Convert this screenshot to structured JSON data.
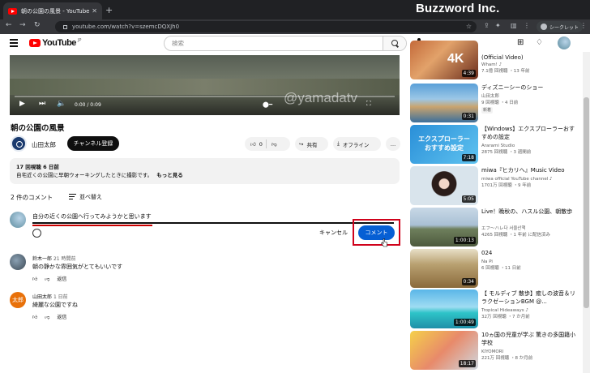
{
  "browser": {
    "tab_title": "朝の公園の風景 - YouTube",
    "new_tab": "+",
    "close": "✕",
    "url": "youtube.com/watch?v=szemcDQXJh0",
    "incognito_label": "シークレット",
    "brand_overlay": "Buzzword Inc."
  },
  "header": {
    "logo_text": "YouTube",
    "logo_jp": "JP",
    "search_placeholder": "検索"
  },
  "player": {
    "current_time": "0:00 / 0:09",
    "watermark": "@yamadatv",
    "progress": 0.0
  },
  "video": {
    "title": "朝の公園の風景",
    "channel_name": "山田太郎",
    "subscribe_label": "チャンネル登録",
    "like_count": "0",
    "share_label": "共有",
    "offline_label": "オフライン",
    "more_label": "…",
    "stats": "17 回視聴  6 日前",
    "description": "自宅近くの公園に早朝ウォーキングしたときに撮影です。",
    "more_link": "もっと見る"
  },
  "comments": {
    "count_label": "2 件のコメント",
    "sort_label": "並べ替え",
    "input_text": "自分の近くの公園へ行ってみようかと思います",
    "cancel_label": "キャンセル",
    "submit_label": "コメント",
    "reply_label": "返信",
    "items": [
      {
        "author": "鈴木一郎",
        "time": "21 時間前",
        "text": "朝の静かな雰囲気がとてもいいです",
        "avatar_color": "#5a6b7a"
      },
      {
        "author": "山田太郎",
        "time": "1 日前",
        "text": "綺麗な公園ですね",
        "avatar_text": "太郎",
        "avatar_color": "#e8710a"
      }
    ]
  },
  "sidebar": {
    "items": [
      {
        "title": "(Official Video)",
        "channel": "Wham! ♪",
        "meta": "7.1億 回視聴 ・13 年前",
        "duration": "4:39",
        "thumb_text": "4K"
      },
      {
        "title": "ディズニーシーのショー",
        "channel": "山田太郎",
        "meta": "9 回視聴 ・4 日前",
        "badge": "新着",
        "duration": "0:31"
      },
      {
        "title": "【Windows】エクスプローラーおすすめの設定",
        "channel": "Ararami Studio",
        "meta": "2875 回視聴 ・3 週間前",
        "duration": "7:18",
        "thumb_text": "エクスプローラー おすすめ設定"
      },
      {
        "title": "miwa『ヒカリへ』Music Video",
        "channel": "miwa official YouTube channel ♪",
        "meta": "1701万 回視聴 ・9 年前",
        "duration": "5:05"
      },
      {
        "title": "Live！晩秋の、ハスル公園、朝散歩",
        "channel": "エフ〜ハレ다 서울산책",
        "meta": "4265 回視聴 ・1 年前 に配信済み",
        "duration": "1:00:13"
      },
      {
        "title": "024",
        "channel": "Na Pi",
        "meta": "6 回視聴 ・11 日前",
        "duration": "0:34"
      },
      {
        "title": "【 モルディブ 散歩】癒しの波音＆リラクゼーションBGM @...",
        "channel": "Tropical Hideaways ♪",
        "meta": "32万 回視聴 ・7 か月前",
        "duration": "1:00:49"
      },
      {
        "title": "10ヵ国の児童が学ぶ 驚きの多国籍小学校",
        "channel": "KIYOMORI",
        "meta": "221万 回視聴 ・8 か月前",
        "duration": "18:17"
      }
    ]
  },
  "colors": {
    "subscribe_bg": "#0f0f0f",
    "comment_button": "#065fd4",
    "highlight_box": "#d0021b",
    "youtube_red": "#ff0000"
  }
}
